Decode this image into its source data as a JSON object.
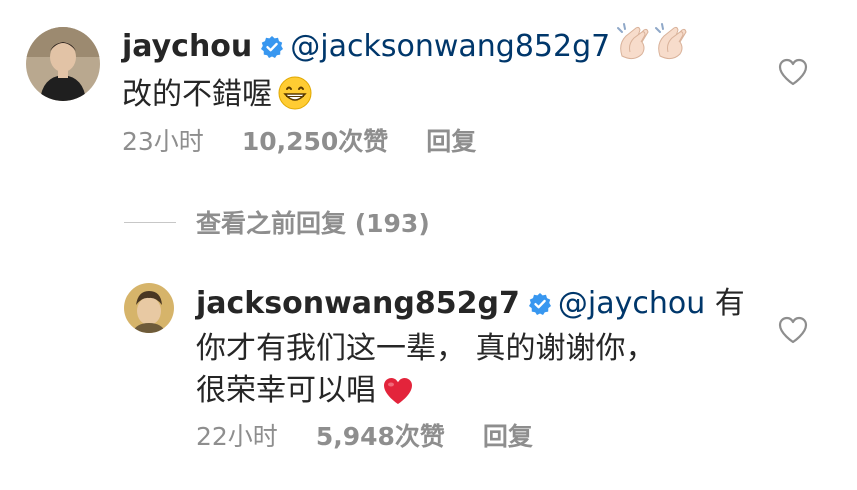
{
  "comment": {
    "username": "jaychou",
    "mention": "@jacksonwang852g7",
    "emoji_after_mention": "clapping-hands-icon",
    "text": "改的不錯喔",
    "emoji_after_text": "grinning-face-icon",
    "time": "23小时",
    "likes": "10,250次赞",
    "reply_label": "回复"
  },
  "view_replies": {
    "label": "查看之前回复 (193)"
  },
  "reply": {
    "username": "jacksonwang852g7",
    "mention": "@jaychou",
    "text_line1_suffix": "有",
    "text_line2": "你才有我们这一辈， 真的谢谢你，",
    "text_line3": "很荣幸可以唱",
    "emoji_after_text": "red-heart-icon",
    "time": "22小时",
    "likes": "5,948次赞",
    "reply_label": "回复"
  },
  "colors": {
    "text": "#262626",
    "mention": "#00376b",
    "meta": "#8e8e8e",
    "verified": "#3897f0"
  }
}
